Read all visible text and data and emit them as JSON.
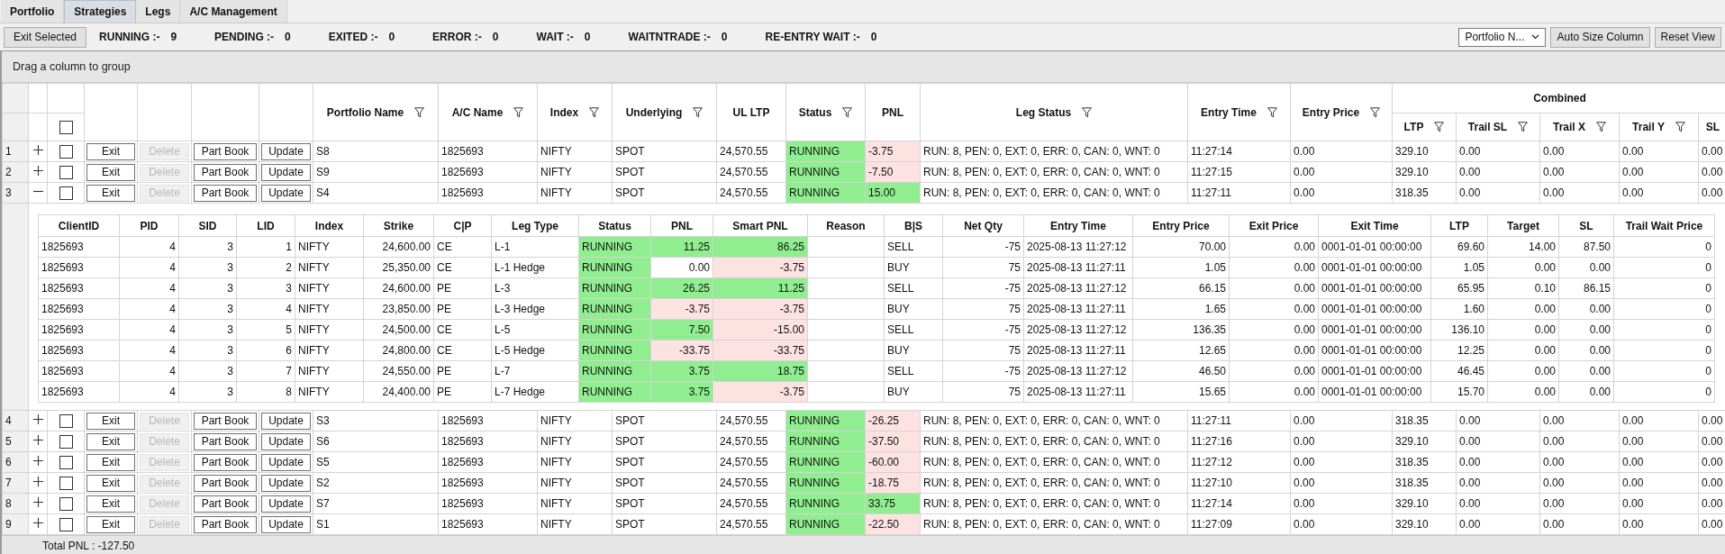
{
  "tabs": [
    {
      "label": "Portfolio",
      "selected": false
    },
    {
      "label": "Strategies",
      "selected": true
    },
    {
      "label": "Legs",
      "selected": false
    },
    {
      "label": "A/C Management",
      "selected": false
    }
  ],
  "toolbar": {
    "exit_selected": "Exit Selected",
    "counters": [
      {
        "label": "RUNNING :-",
        "value": "9"
      },
      {
        "label": "PENDING :-",
        "value": "0"
      },
      {
        "label": "EXITED :-",
        "value": "0"
      },
      {
        "label": "ERROR :-",
        "value": "0"
      },
      {
        "label": "WAIT :-",
        "value": "0"
      },
      {
        "label": "WAITNTRADE :-",
        "value": "0"
      },
      {
        "label": "RE-ENTRY WAIT :-",
        "value": "0"
      }
    ],
    "dropdown": "Portfolio N...",
    "buttons": [
      "Auto Size Column",
      "Reset View"
    ]
  },
  "group_panel": "Drag a column to group",
  "columns": [
    {
      "label": "Portfolio Name",
      "filter": true
    },
    {
      "label": "A/C Name",
      "filter": true
    },
    {
      "label": "Index",
      "filter": true
    },
    {
      "label": "Underlying",
      "filter": true
    },
    {
      "label": "UL LTP",
      "filter": false
    },
    {
      "label": "Status",
      "filter": true
    },
    {
      "label": "PNL",
      "filter": false
    },
    {
      "label": "Leg Status",
      "filter": true
    },
    {
      "label": "Entry Time",
      "filter": true
    },
    {
      "label": "Entry Price",
      "filter": true
    },
    {
      "label": "LTP",
      "filter": true
    },
    {
      "label": "Trail SL",
      "filter": true
    },
    {
      "label": "Trail X",
      "filter": true
    },
    {
      "label": "Trail Y",
      "filter": true
    },
    {
      "label": "SL",
      "filter": false
    }
  ],
  "column_group": "Combined",
  "header_checkbox": {
    "checked": false
  },
  "leg_columns": [
    "ClientID",
    "PID",
    "SID",
    "LID",
    "Index",
    "Strike",
    "C|P",
    "Leg Type",
    "Status",
    "PNL",
    "Smart PNL",
    "Reason",
    "B|S",
    "Net Qty",
    "Entry Time",
    "Entry Price",
    "Exit Price",
    "Exit Time",
    "LTP",
    "Target",
    "SL",
    "Trail Wait Price"
  ],
  "rows": [
    {
      "number": "1",
      "expanded": false,
      "checked": false,
      "actions": [
        {
          "label": "Exit",
          "disabled": false
        },
        {
          "label": "Delete",
          "disabled": true
        },
        {
          "label": "Part Book",
          "disabled": false
        },
        {
          "label": "Update",
          "disabled": false
        }
      ],
      "pnl": {
        "value": "-3.75",
        "color": "#fde2e2"
      },
      "cells": [
        "S8",
        "1825693",
        "NIFTY",
        "SPOT",
        "24,570.55",
        "RUNNING",
        "RUN: 8, PEN: 0, EXT: 0, ERR: 0, CAN: 0, WNT: 0",
        "11:27:14",
        "0.00",
        "329.10",
        "0.00",
        "0.00",
        "0.00",
        "0.00"
      ]
    },
    {
      "number": "2",
      "expanded": false,
      "checked": false,
      "actions": [
        {
          "label": "Exit",
          "disabled": false
        },
        {
          "label": "Delete",
          "disabled": true
        },
        {
          "label": "Part Book",
          "disabled": false
        },
        {
          "label": "Update",
          "disabled": false
        }
      ],
      "pnl": {
        "value": "-7.50",
        "color": "#fde2e2"
      },
      "cells": [
        "S9",
        "1825693",
        "NIFTY",
        "SPOT",
        "24,570.55",
        "RUNNING",
        "RUN: 8, PEN: 0, EXT: 0, ERR: 0, CAN: 0, WNT: 0",
        "11:27:15",
        "0.00",
        "329.10",
        "0.00",
        "0.00",
        "0.00",
        "0.00"
      ]
    },
    {
      "number": "3",
      "expanded": true,
      "checked": false,
      "actions": [
        {
          "label": "Exit",
          "disabled": false
        },
        {
          "label": "Delete",
          "disabled": true
        },
        {
          "label": "Part Book",
          "disabled": false
        },
        {
          "label": "Update",
          "disabled": false
        }
      ],
      "pnl": {
        "value": "15.00",
        "color": "#90ee90"
      },
      "cells": [
        "S4",
        "1825693",
        "NIFTY",
        "SPOT",
        "24,570.55",
        "RUNNING",
        "RUN: 8, PEN: 0, EXT: 0, ERR: 0, CAN: 0, WNT: 0",
        "11:27:11",
        "0.00",
        "318.35",
        "0.00",
        "0.00",
        "0.00",
        "0.00"
      ],
      "legs": [
        {
          "pnl": {
            "value": "11.25",
            "color": "#90ee90"
          },
          "smart_pnl": {
            "value": "86.25",
            "color": "#90ee90"
          },
          "cells": [
            "1825693",
            "4",
            "3",
            "1",
            "NIFTY",
            "24,600.00",
            "CE",
            "L-1",
            "RUNNING",
            "SELL",
            "-75",
            "2025-08-13 11:27:12",
            "70.00",
            "0.00",
            "0001-01-01 00:00:00",
            "69.60",
            "14.00",
            "87.50",
            "0"
          ]
        },
        {
          "pnl": {
            "value": "0.00"
          },
          "smart_pnl": {
            "value": "-3.75",
            "color": "#fde2e2"
          },
          "cells": [
            "1825693",
            "4",
            "3",
            "2",
            "NIFTY",
            "25,350.00",
            "CE",
            "L-1 Hedge",
            "RUNNING",
            "BUY",
            "75",
            "2025-08-13 11:27:11",
            "1.05",
            "0.00",
            "0001-01-01 00:00:00",
            "1.05",
            "0.00",
            "0.00",
            "0"
          ]
        },
        {
          "pnl": {
            "value": "26.25",
            "color": "#90ee90"
          },
          "smart_pnl": {
            "value": "11.25",
            "color": "#90ee90"
          },
          "cells": [
            "1825693",
            "4",
            "3",
            "3",
            "NIFTY",
            "24,600.00",
            "PE",
            "L-3",
            "RUNNING",
            "SELL",
            "-75",
            "2025-08-13 11:27:12",
            "66.15",
            "0.00",
            "0001-01-01 00:00:00",
            "65.95",
            "0.10",
            "86.15",
            "0"
          ]
        },
        {
          "pnl": {
            "value": "-3.75",
            "color": "#fde2e2"
          },
          "smart_pnl": {
            "value": "-3.75",
            "color": "#fde2e2"
          },
          "cells": [
            "1825693",
            "4",
            "3",
            "4",
            "NIFTY",
            "23,850.00",
            "PE",
            "L-3 Hedge",
            "RUNNING",
            "BUY",
            "75",
            "2025-08-13 11:27:11",
            "1.65",
            "0.00",
            "0001-01-01 00:00:00",
            "1.60",
            "0.00",
            "0.00",
            "0"
          ]
        },
        {
          "pnl": {
            "value": "7.50",
            "color": "#90ee90"
          },
          "smart_pnl": {
            "value": "-15.00",
            "color": "#fde2e2"
          },
          "cells": [
            "1825693",
            "4",
            "3",
            "5",
            "NIFTY",
            "24,500.00",
            "CE",
            "L-5",
            "RUNNING",
            "SELL",
            "-75",
            "2025-08-13 11:27:12",
            "136.35",
            "0.00",
            "0001-01-01 00:00:00",
            "136.10",
            "0.00",
            "0.00",
            "0"
          ]
        },
        {
          "pnl": {
            "value": "-33.75",
            "color": "#fde2e2"
          },
          "smart_pnl": {
            "value": "-33.75",
            "color": "#fde2e2"
          },
          "cells": [
            "1825693",
            "4",
            "3",
            "6",
            "NIFTY",
            "24,800.00",
            "CE",
            "L-5 Hedge",
            "RUNNING",
            "BUY",
            "75",
            "2025-08-13 11:27:11",
            "12.65",
            "0.00",
            "0001-01-01 00:00:00",
            "12.25",
            "0.00",
            "0.00",
            "0"
          ]
        },
        {
          "pnl": {
            "value": "3.75",
            "color": "#90ee90"
          },
          "smart_pnl": {
            "value": "18.75",
            "color": "#90ee90"
          },
          "cells": [
            "1825693",
            "4",
            "3",
            "7",
            "NIFTY",
            "24,550.00",
            "PE",
            "L-7",
            "RUNNING",
            "SELL",
            "-75",
            "2025-08-13 11:27:12",
            "46.50",
            "0.00",
            "0001-01-01 00:00:00",
            "46.45",
            "0.00",
            "0.00",
            "0"
          ]
        },
        {
          "pnl": {
            "value": "3.75",
            "color": "#90ee90"
          },
          "smart_pnl": {
            "value": "-3.75",
            "color": "#fde2e2"
          },
          "cells": [
            "1825693",
            "4",
            "3",
            "8",
            "NIFTY",
            "24,400.00",
            "PE",
            "L-7 Hedge",
            "RUNNING",
            "BUY",
            "75",
            "2025-08-13 11:27:11",
            "15.65",
            "0.00",
            "0001-01-01 00:00:00",
            "15.70",
            "0.00",
            "0.00",
            "0"
          ]
        }
      ]
    },
    {
      "number": "4",
      "expanded": false,
      "checked": false,
      "actions": [
        {
          "label": "Exit",
          "disabled": false
        },
        {
          "label": "Delete",
          "disabled": true
        },
        {
          "label": "Part Book",
          "disabled": false
        },
        {
          "label": "Update",
          "disabled": false
        }
      ],
      "pnl": {
        "value": "-26.25",
        "color": "#fde2e2"
      },
      "cells": [
        "S3",
        "1825693",
        "NIFTY",
        "SPOT",
        "24,570.55",
        "RUNNING",
        "RUN: 8, PEN: 0, EXT: 0, ERR: 0, CAN: 0, WNT: 0",
        "11:27:11",
        "0.00",
        "318.35",
        "0.00",
        "0.00",
        "0.00",
        "0.00"
      ]
    },
    {
      "number": "5",
      "expanded": false,
      "checked": false,
      "actions": [
        {
          "label": "Exit",
          "disabled": false
        },
        {
          "label": "Delete",
          "disabled": true
        },
        {
          "label": "Part Book",
          "disabled": false
        },
        {
          "label": "Update",
          "disabled": false
        }
      ],
      "pnl": {
        "value": "-37.50",
        "color": "#fde2e2"
      },
      "cells": [
        "S6",
        "1825693",
        "NIFTY",
        "SPOT",
        "24,570.55",
        "RUNNING",
        "RUN: 8, PEN: 0, EXT: 0, ERR: 0, CAN: 0, WNT: 0",
        "11:27:16",
        "0.00",
        "329.10",
        "0.00",
        "0.00",
        "0.00",
        "0.00"
      ]
    },
    {
      "number": "6",
      "expanded": false,
      "checked": false,
      "actions": [
        {
          "label": "Exit",
          "disabled": false
        },
        {
          "label": "Delete",
          "disabled": true
        },
        {
          "label": "Part Book",
          "disabled": false
        },
        {
          "label": "Update",
          "disabled": false
        }
      ],
      "pnl": {
        "value": "-60.00",
        "color": "#fde2e2"
      },
      "cells": [
        "S5",
        "1825693",
        "NIFTY",
        "SPOT",
        "24,570.55",
        "RUNNING",
        "RUN: 8, PEN: 0, EXT: 0, ERR: 0, CAN: 0, WNT: 0",
        "11:27:12",
        "0.00",
        "318.35",
        "0.00",
        "0.00",
        "0.00",
        "0.00"
      ]
    },
    {
      "number": "7",
      "expanded": false,
      "checked": false,
      "actions": [
        {
          "label": "Exit",
          "disabled": false
        },
        {
          "label": "Delete",
          "disabled": true
        },
        {
          "label": "Part Book",
          "disabled": false
        },
        {
          "label": "Update",
          "disabled": false
        }
      ],
      "pnl": {
        "value": "-18.75",
        "color": "#fde2e2"
      },
      "cells": [
        "S2",
        "1825693",
        "NIFTY",
        "SPOT",
        "24,570.55",
        "RUNNING",
        "RUN: 8, PEN: 0, EXT: 0, ERR: 0, CAN: 0, WNT: 0",
        "11:27:10",
        "0.00",
        "318.35",
        "0.00",
        "0.00",
        "0.00",
        "0.00"
      ]
    },
    {
      "number": "8",
      "expanded": false,
      "checked": false,
      "actions": [
        {
          "label": "Exit",
          "disabled": false
        },
        {
          "label": "Delete",
          "disabled": true
        },
        {
          "label": "Part Book",
          "disabled": false
        },
        {
          "label": "Update",
          "disabled": false
        }
      ],
      "pnl": {
        "value": "33.75",
        "color": "#90ee90"
      },
      "cells": [
        "S7",
        "1825693",
        "NIFTY",
        "SPOT",
        "24,570.55",
        "RUNNING",
        "RUN: 8, PEN: 0, EXT: 0, ERR: 0, CAN: 0, WNT: 0",
        "11:27:14",
        "0.00",
        "329.10",
        "0.00",
        "0.00",
        "0.00",
        "0.00"
      ]
    },
    {
      "number": "9",
      "expanded": false,
      "checked": false,
      "actions": [
        {
          "label": "Exit",
          "disabled": false
        },
        {
          "label": "Delete",
          "disabled": true
        },
        {
          "label": "Part Book",
          "disabled": false
        },
        {
          "label": "Update",
          "disabled": false
        }
      ],
      "pnl": {
        "value": "-22.50",
        "color": "#fde2e2"
      },
      "cells": [
        "S1",
        "1825693",
        "NIFTY",
        "SPOT",
        "24,570.55",
        "RUNNING",
        "RUN: 8, PEN: 0, EXT: 0, ERR: 0, CAN: 0, WNT: 0",
        "11:27:09",
        "0.00",
        "329.10",
        "0.00",
        "0.00",
        "0.00",
        "0.00"
      ]
    }
  ],
  "footer": "Total PNL : -127.50"
}
